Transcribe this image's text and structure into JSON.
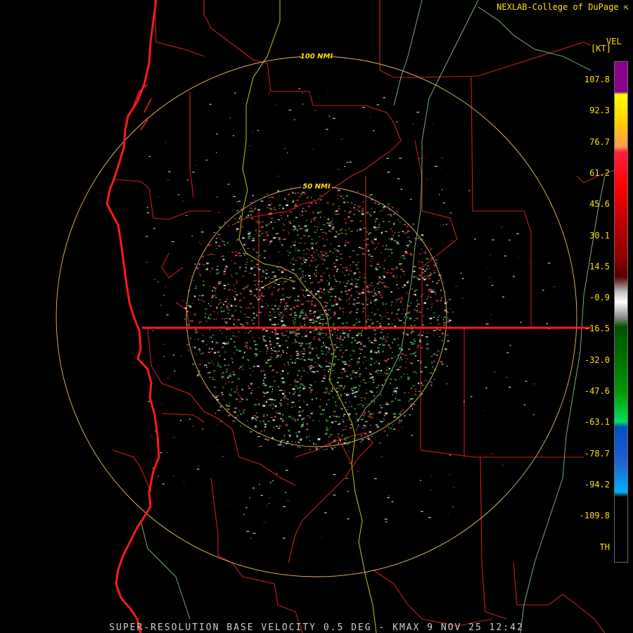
{
  "header": {
    "credit": "NEXLAB-College of DuPage ⇱"
  },
  "legend": {
    "product": "VEL",
    "unit": "[KT]",
    "ticks": [
      "107.8",
      "92.3",
      "76.7",
      "61.2",
      "45.6",
      "30.1",
      "14.5",
      "-0.9",
      "-16.5",
      "-32.0",
      "-47.6",
      "-63.1",
      "-78.7",
      "-94.2",
      "-109.8",
      "TH"
    ]
  },
  "range_rings": [
    {
      "label": "100 NMI",
      "nmi": 100
    },
    {
      "label": "50 NMI",
      "nmi": 50
    }
  ],
  "colors": {
    "ring": "#e8b870",
    "boundary": "#c81e1e",
    "coast": "#ff1a1a",
    "label": "#ffe000"
  },
  "footer": {
    "caption": "SUPER-RESOLUTION BASE VELOCITY 0.5 DEG - KMAX 9 NOV 25 12:42"
  }
}
